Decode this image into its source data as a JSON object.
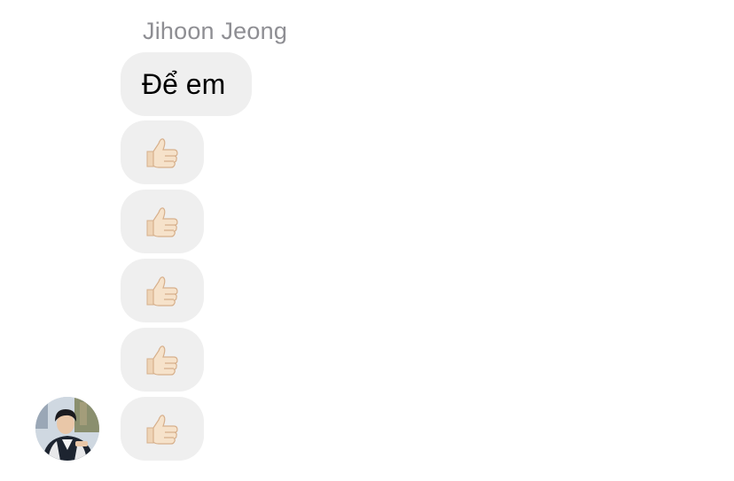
{
  "conversation": {
    "sender_name": "Jihoon Jeong",
    "messages": [
      {
        "type": "text",
        "text": "Để em"
      },
      {
        "type": "emoji",
        "icon": "thumbs-up-light-skin-icon"
      },
      {
        "type": "emoji",
        "icon": "thumbs-up-light-skin-icon"
      },
      {
        "type": "emoji",
        "icon": "thumbs-up-light-skin-icon"
      },
      {
        "type": "emoji",
        "icon": "thumbs-up-light-skin-icon"
      },
      {
        "type": "emoji",
        "icon": "thumbs-up-light-skin-icon"
      }
    ],
    "avatar": {
      "icon": "user-avatar-photo"
    }
  },
  "colors": {
    "bubble_background": "#efefef",
    "sender_name": "#8e8e93",
    "message_text": "#000000",
    "thumb_skin": "#f3dcc3"
  }
}
